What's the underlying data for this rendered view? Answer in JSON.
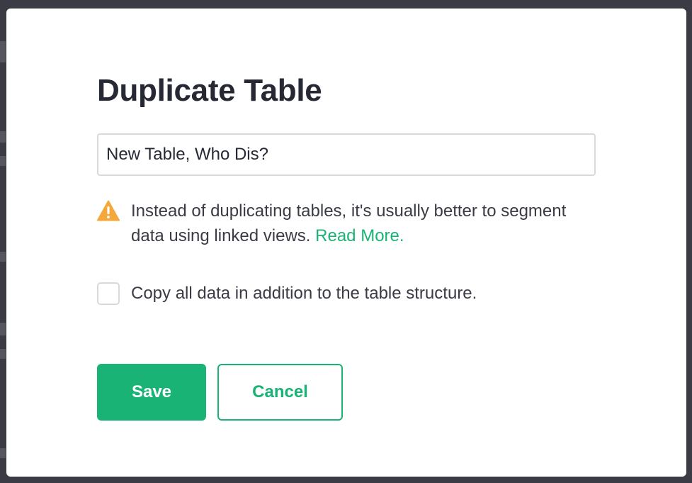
{
  "dialog": {
    "title": "Duplicate Table",
    "name_input": {
      "value": "New Table, Who Dis?"
    },
    "warning": {
      "icon": "warning-triangle-icon",
      "text": "Instead of duplicating tables, it's usually better to segment data using linked views. ",
      "link_label": "Read More."
    },
    "copy_data": {
      "label": "Copy all data in addition to the table structure.",
      "checked": false
    },
    "buttons": {
      "save_label": "Save",
      "cancel_label": "Cancel"
    }
  },
  "colors": {
    "accent": "#19b376",
    "warning": "#f4a83a",
    "text": "#262833",
    "backdrop": "#3a3b44",
    "border": "#d8d9dd"
  }
}
